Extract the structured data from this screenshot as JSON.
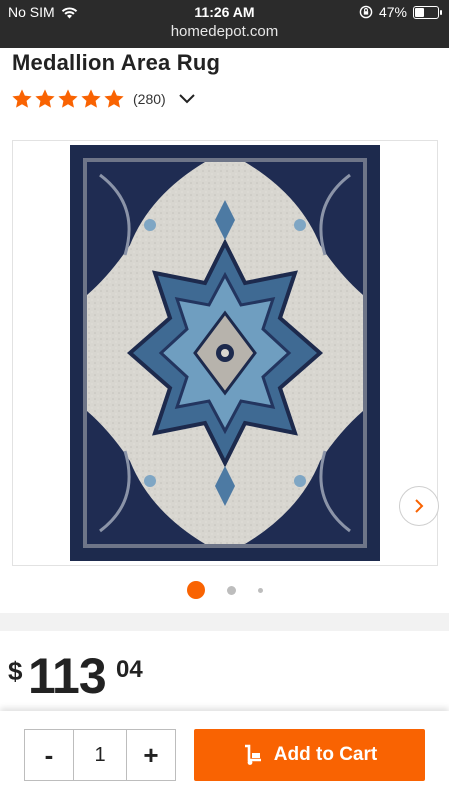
{
  "status_bar": {
    "carrier": "No SIM",
    "time": "11:26 AM",
    "battery": "47%",
    "battery_level": 0.47,
    "url": "homedepot.com",
    "icons": [
      "wifi-icon",
      "orientation-lock-icon",
      "battery-icon"
    ]
  },
  "product": {
    "title": "Medallion Area Rug",
    "rating": 5,
    "review_count": "(280)",
    "image_alt": "Navy and ivory medallion area rug",
    "carousel": {
      "total": 3,
      "active_index": 0
    }
  },
  "price": {
    "currency": "$",
    "dollars": "113",
    "cents": "04"
  },
  "cart": {
    "minus_label": "-",
    "quantity": "1",
    "plus_label": "+",
    "add_label": "Add to Cart"
  },
  "colors": {
    "brand_orange": "#f96302",
    "navy": "#1d2a4d",
    "ivory": "#dcdad4"
  }
}
